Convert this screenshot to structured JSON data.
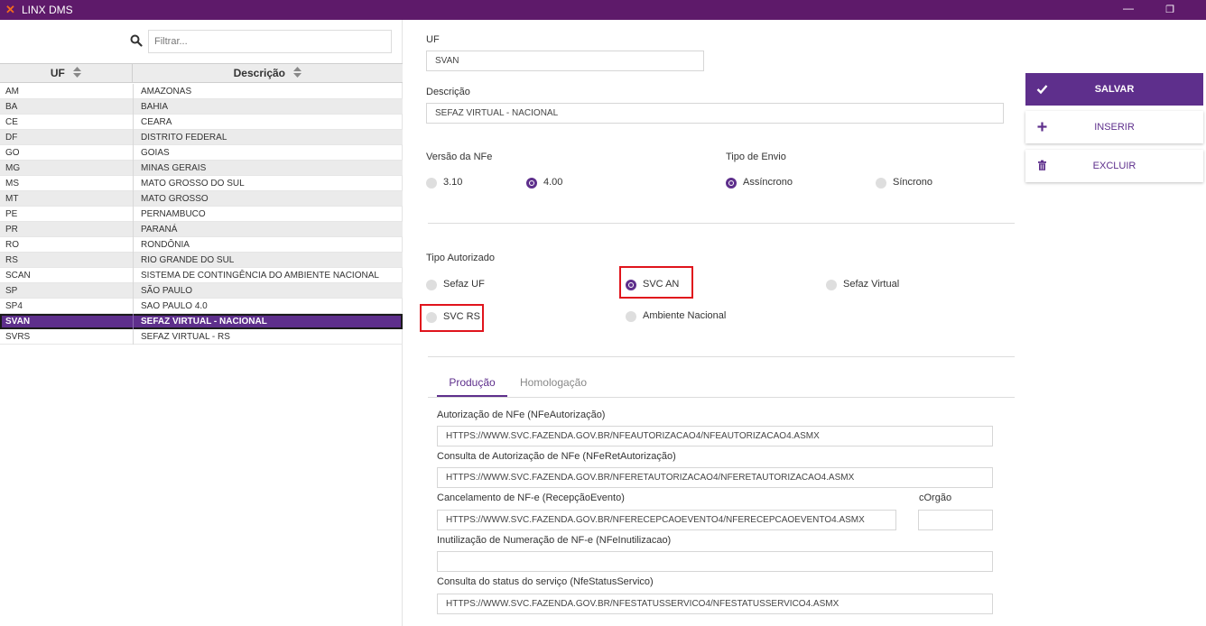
{
  "app": {
    "title": "LINX DMS",
    "minimize_glyph": "—",
    "restore_glyph": "❐"
  },
  "colors": {
    "titlebar": "#5e1a6a",
    "accent": "#5e2f8c",
    "highlight": "#e0141c",
    "logo": "#f26b1d"
  },
  "left": {
    "filter_placeholder": "Filtrar...",
    "headers": {
      "uf": "UF",
      "descricao": "Descrição"
    },
    "rows": [
      {
        "uf": "AM",
        "desc": "AMAZONAS"
      },
      {
        "uf": "BA",
        "desc": "BAHIA"
      },
      {
        "uf": "CE",
        "desc": "CEARA"
      },
      {
        "uf": "DF",
        "desc": "DISTRITO FEDERAL"
      },
      {
        "uf": "GO",
        "desc": "GOIAS"
      },
      {
        "uf": "MG",
        "desc": "MINAS GERAIS"
      },
      {
        "uf": "MS",
        "desc": "MATO GROSSO DO SUL"
      },
      {
        "uf": "MT",
        "desc": "MATO GROSSO"
      },
      {
        "uf": "PE",
        "desc": "PERNAMBUCO"
      },
      {
        "uf": "PR",
        "desc": "PARANÁ"
      },
      {
        "uf": "RO",
        "desc": "RONDÔNIA"
      },
      {
        "uf": "RS",
        "desc": "RIO GRANDE DO SUL"
      },
      {
        "uf": "SCAN",
        "desc": "SISTEMA DE CONTINGÊNCIA DO AMBIENTE NACIONAL"
      },
      {
        "uf": "SP",
        "desc": "SÃO PAULO"
      },
      {
        "uf": "SP4",
        "desc": "SAO PAULO 4.0"
      },
      {
        "uf": "SVAN",
        "desc": "SEFAZ VIRTUAL - NACIONAL"
      },
      {
        "uf": "SVRS",
        "desc": "SEFAZ VIRTUAL - RS"
      }
    ],
    "selected_uf": "SVAN"
  },
  "form": {
    "uf_label": "UF",
    "uf_value": "SVAN",
    "descricao_label": "Descrição",
    "descricao_value": "SEFAZ VIRTUAL - NACIONAL",
    "versao_label": "Versão da NFe",
    "versao_options": {
      "v310": "3.10",
      "v400": "4.00"
    },
    "versao_selected": "4.00",
    "tipo_envio_label": "Tipo de Envio",
    "tipo_envio_options": {
      "assincrono": "Assíncrono",
      "sincrono": "Síncrono"
    },
    "tipo_envio_selected": "Assíncrono",
    "tipo_autorizado_label": "Tipo Autorizado",
    "tipo_autorizado_options": {
      "sefaz_uf": "Sefaz UF",
      "svc_an": "SVC AN",
      "sefaz_virtual": "Sefaz Virtual",
      "svc_rs": "SVC RS",
      "ambiente_nacional": "Ambiente Nacional"
    },
    "tipo_autorizado_selected": "SVC AN",
    "tabs": {
      "producao": "Produção",
      "homologacao": "Homologação"
    },
    "active_tab": "Produção",
    "services": {
      "autorizacao_label": "Autorização de NFe (NFeAutorização)",
      "autorizacao_value": "HTTPS://WWW.SVC.FAZENDA.GOV.BR/NFEAUTORIZACAO4/NFEAUTORIZACAO4.ASMX",
      "ret_autorizacao_label": "Consulta de Autorização de NFe (NFeRetAutorização)",
      "ret_autorizacao_value": "HTTPS://WWW.SVC.FAZENDA.GOV.BR/NFERETAUTORIZACAO4/NFERETAUTORIZACAO4.ASMX",
      "cancelamento_label": "Cancelamento de NF-e (RecepçãoEvento)",
      "cancelamento_value": "HTTPS://WWW.SVC.FAZENDA.GOV.BR/NFERECEPCAOEVENTO4/NFERECEPCAOEVENTO4.ASMX",
      "corgao_label": "cOrgão",
      "corgao_value": "",
      "inutilizacao_label": "Inutilização de Numeração de NF-e (NFeInutilizacao)",
      "inutilizacao_value": "",
      "status_label": "Consulta do status do serviço (NfeStatusServico)",
      "status_value": "HTTPS://WWW.SVC.FAZENDA.GOV.BR/NFESTATUSSERVICO4/NFESTATUSSERVICO4.ASMX"
    }
  },
  "actions": {
    "salvar": "SALVAR",
    "inserir": "INSERIR",
    "excluir": "EXCLUIR"
  },
  "icons": {
    "logo": "linx-logo-icon",
    "search": "search-icon",
    "sort": "sort-icon",
    "salvar": "check-icon",
    "inserir": "plus-icon",
    "excluir": "trash-icon"
  }
}
